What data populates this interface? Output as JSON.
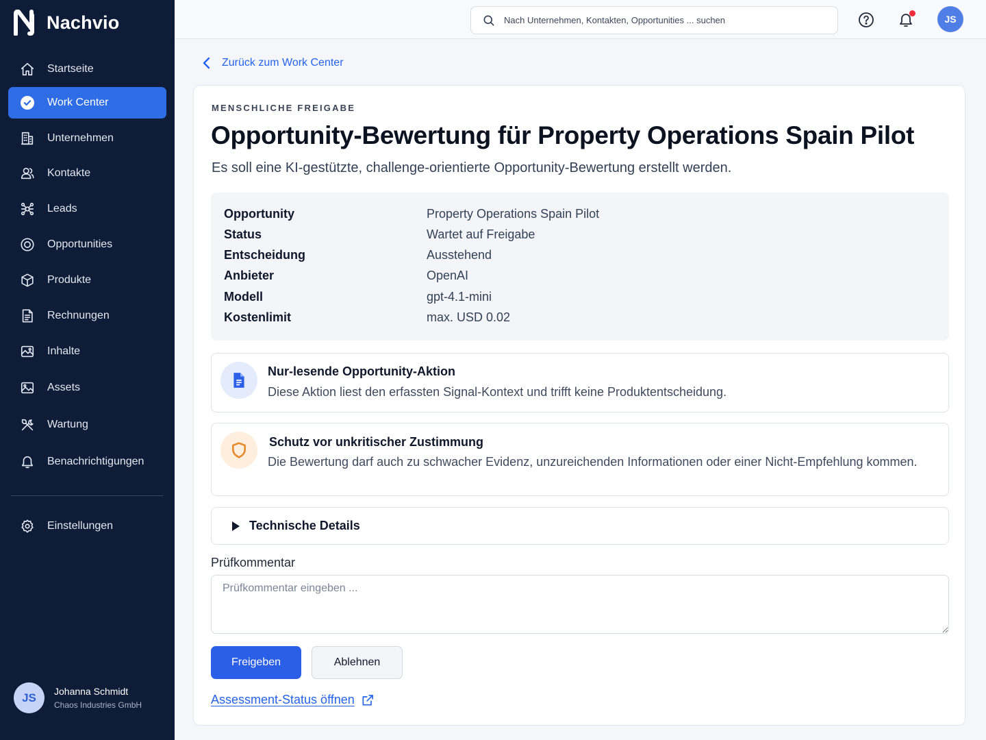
{
  "brand": {
    "name": "Nachvio"
  },
  "sidebar": {
    "items": [
      {
        "label": "Startseite",
        "icon": "home-icon"
      },
      {
        "label": "Work Center",
        "icon": "check-circle-icon",
        "active": true
      },
      {
        "label": "Unternehmen",
        "icon": "building-icon"
      },
      {
        "label": "Kontakte",
        "icon": "users-icon"
      },
      {
        "label": "Leads",
        "icon": "network-icon"
      },
      {
        "label": "Opportunities",
        "icon": "target-icon"
      },
      {
        "label": "Produkte",
        "icon": "box-icon"
      },
      {
        "label": "Rechnungen",
        "icon": "invoice-icon"
      },
      {
        "label": "Inhalte",
        "icon": "image-icon"
      },
      {
        "label": "Assets",
        "icon": "picture-icon"
      },
      {
        "label": "Wartung",
        "icon": "tools-icon"
      },
      {
        "label": "Benachrichtigungen",
        "icon": "bell-icon"
      },
      {
        "label": "Einstellungen",
        "icon": "gear-icon"
      }
    ],
    "user": {
      "initials": "JS",
      "name": "Johanna Schmidt",
      "company": "Chaos Industries GmbH"
    }
  },
  "topbar": {
    "search_placeholder": "Nach Unternehmen, Kontakten, Opportunities ... suchen",
    "avatar_initials": "JS",
    "notification_dot_color": "#ef2b3c"
  },
  "back_link": "Zurück zum Work Center",
  "card": {
    "eyebrow": "MENSCHLICHE FREIGABE",
    "title": "Opportunity-Bewertung für Property Operations Spain Pilot",
    "subtitle": "Es soll eine KI-gestützte, challenge-orientierte Opportunity-Bewertung erstellt werden.",
    "meta": [
      {
        "key": "Opportunity",
        "value": "Property Operations Spain Pilot"
      },
      {
        "key": "Status",
        "value": "Wartet auf Freigabe"
      },
      {
        "key": "Entscheidung",
        "value": "Ausstehend"
      },
      {
        "key": "Anbieter",
        "value": "OpenAI"
      },
      {
        "key": "Modell",
        "value": "gpt-4.1-mini"
      },
      {
        "key": "Kostenlimit",
        "value": "max. USD 0.02"
      }
    ],
    "notice_readonly": {
      "title": "Nur-lesende Opportunity-Aktion",
      "text": "Diese Aktion liest den erfassten Signal-Kontext und trifft keine Produktentscheidung.",
      "icon": "document-icon"
    },
    "notice_protection": {
      "title": "Schutz vor unkritischer Zustimmung",
      "text": "Die Bewertung darf auch zu schwacher Evidenz, unzureichenden Informationen oder einer Nicht-Empfehlung kommen.",
      "icon": "shield-icon"
    },
    "details_label": "Technische Details",
    "comment_label": "Prüfkommentar",
    "comment_placeholder": "Prüfkommentar eingeben ...",
    "approve_label": "Freigeben",
    "reject_label": "Ablehnen",
    "status_link": "Assessment-Status öffnen"
  },
  "colors": {
    "sidebar_bg": "#0f1c38",
    "accent": "#2f6de6",
    "primary_button": "#2b5fe8",
    "link": "#2563eb"
  }
}
